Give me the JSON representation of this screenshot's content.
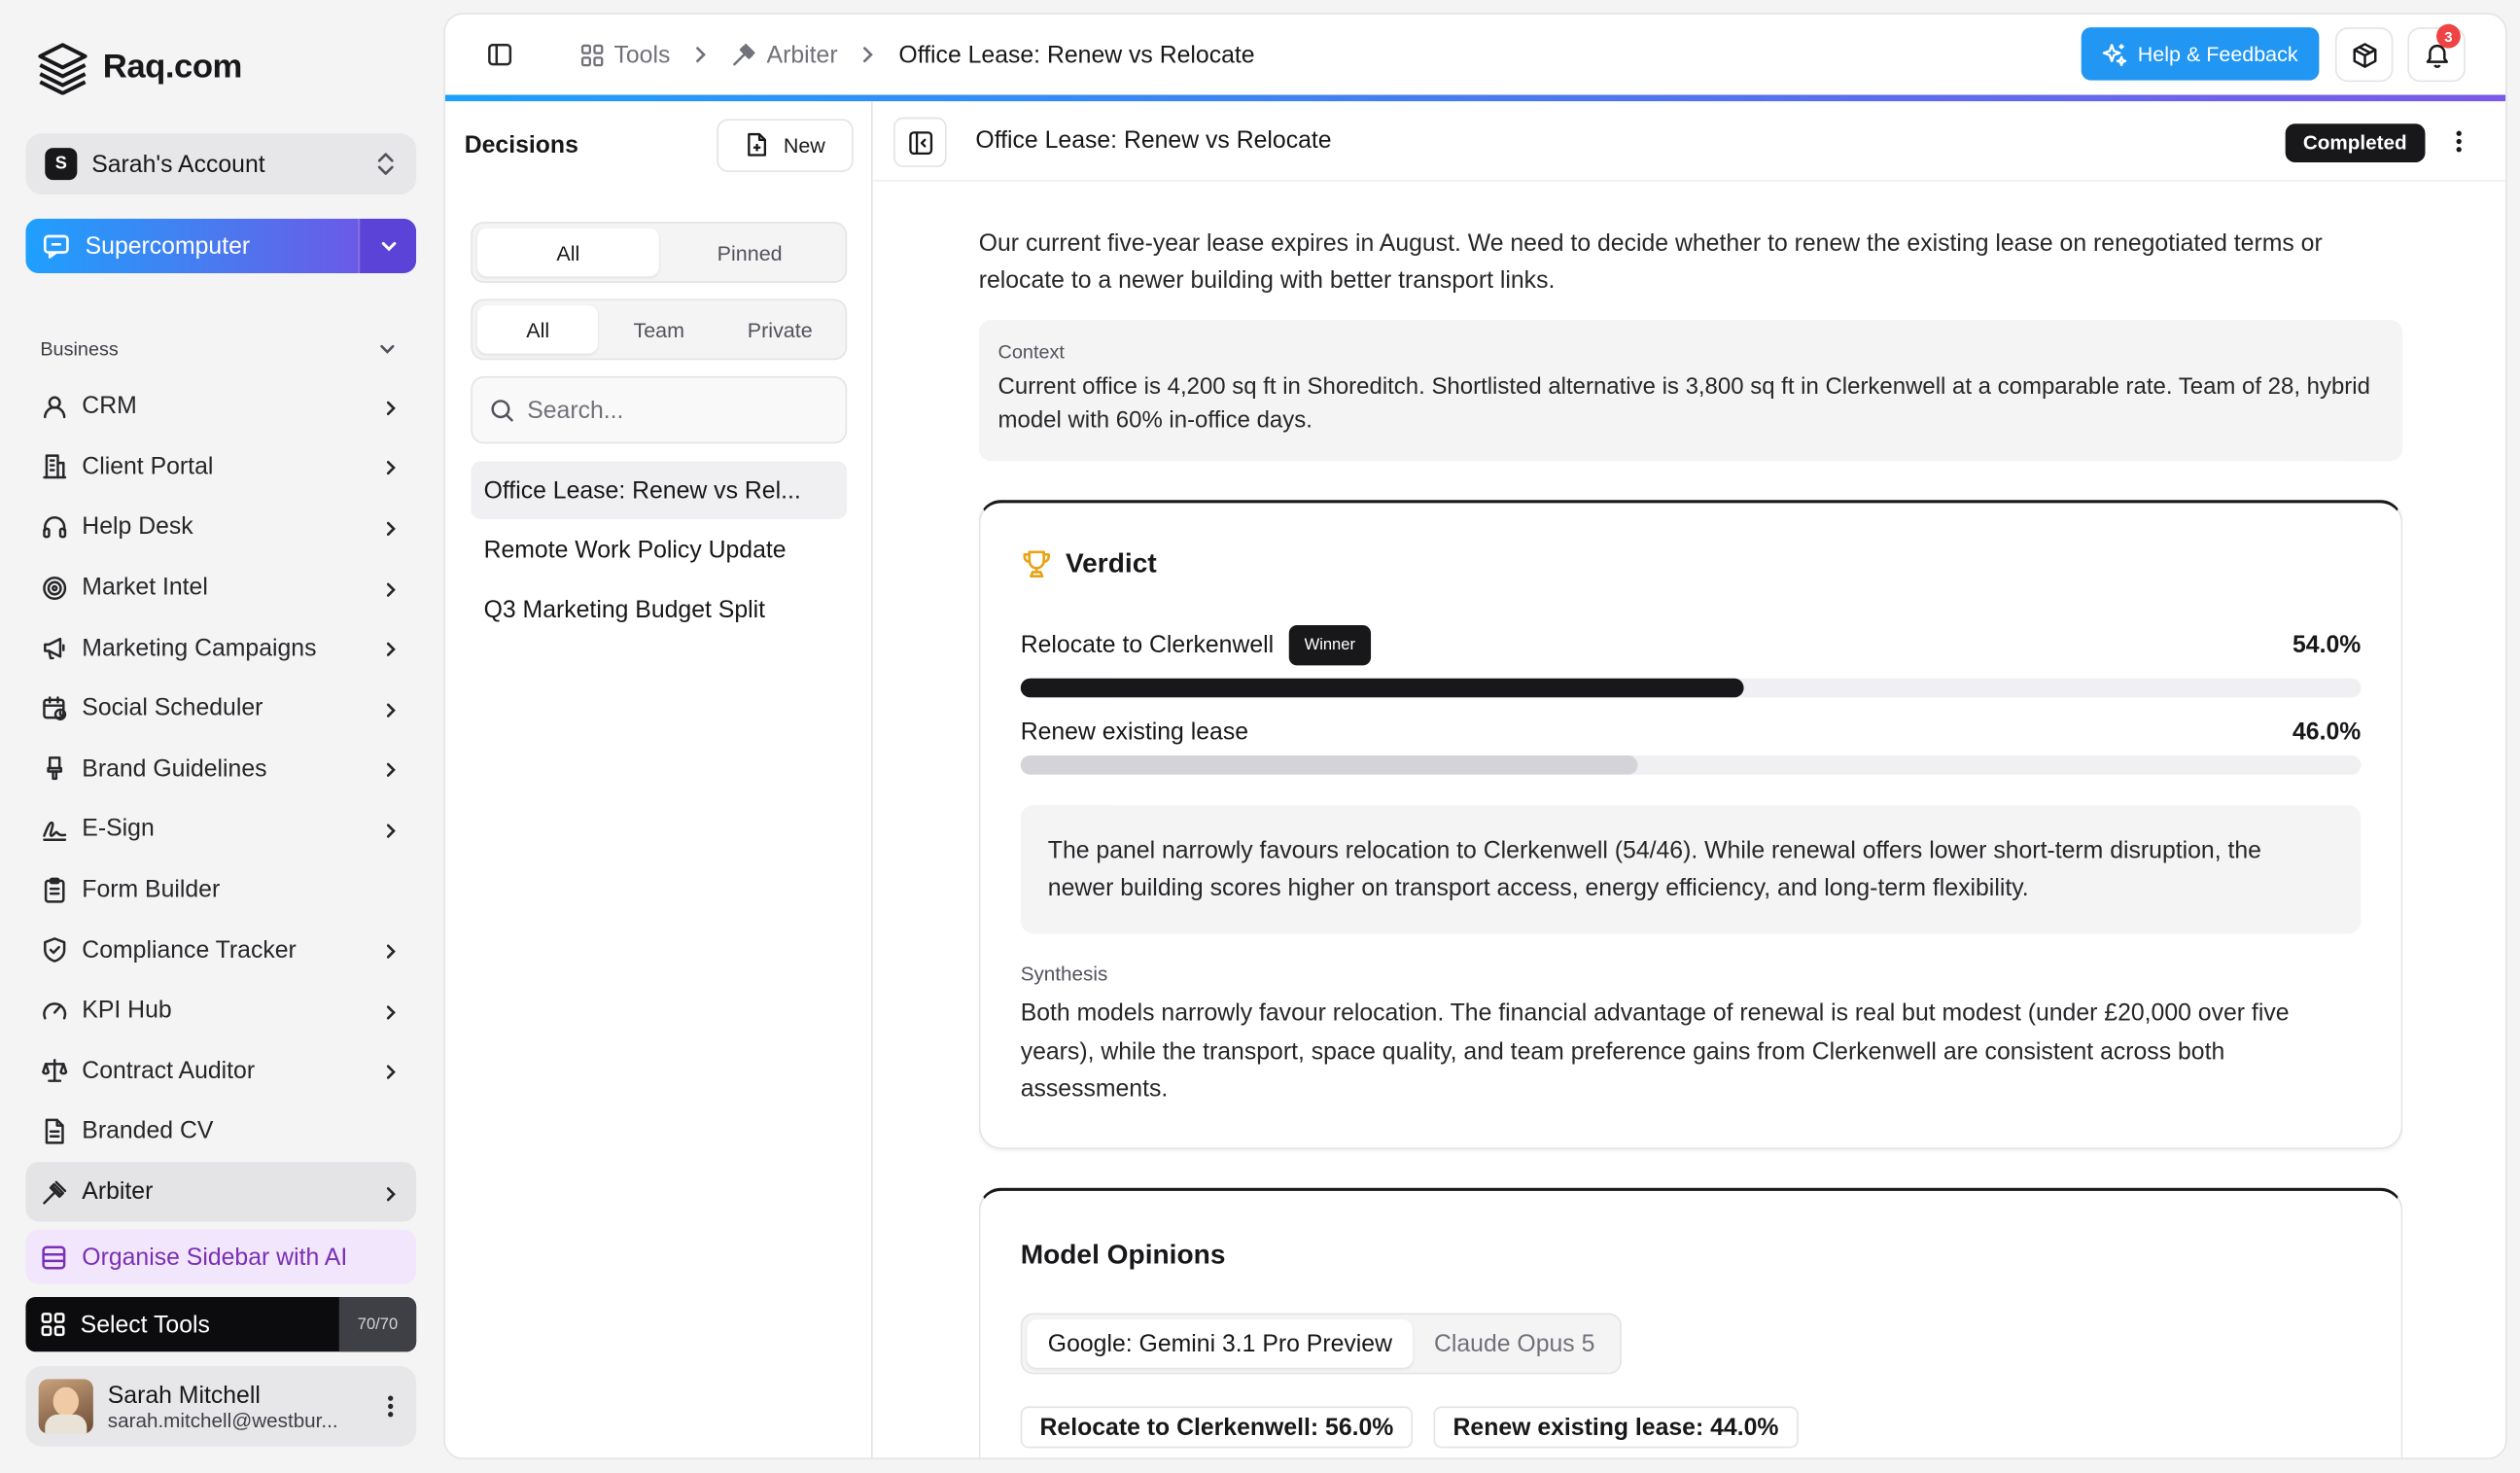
{
  "app": {
    "brand": "Raq.com"
  },
  "account": {
    "name": "Sarah's Account",
    "initial": "S"
  },
  "supercomputer": {
    "label": "Supercomputer"
  },
  "sidebar": {
    "group": "Business",
    "items": [
      {
        "label": "CRM",
        "icon": "user-icon"
      },
      {
        "label": "Client Portal",
        "icon": "building-icon"
      },
      {
        "label": "Help Desk",
        "icon": "headset-icon"
      },
      {
        "label": "Market Intel",
        "icon": "target-icon"
      },
      {
        "label": "Marketing Campaigns",
        "icon": "megaphone-icon"
      },
      {
        "label": "Social Scheduler",
        "icon": "calendar-clock-icon"
      },
      {
        "label": "Brand Guidelines",
        "icon": "brush-icon"
      },
      {
        "label": "E-Sign",
        "icon": "signature-icon"
      },
      {
        "label": "Form Builder",
        "icon": "clipboard-icon"
      },
      {
        "label": "Compliance Tracker",
        "icon": "shield-check-icon"
      },
      {
        "label": "KPI Hub",
        "icon": "gauge-icon"
      },
      {
        "label": "Contract Auditor",
        "icon": "scale-icon"
      },
      {
        "label": "Branded CV",
        "icon": "file-icon"
      },
      {
        "label": "Arbiter",
        "icon": "gavel-icon"
      }
    ],
    "organise": "Organise Sidebar with AI",
    "select_tools": "Select Tools",
    "tools_count": "70/70"
  },
  "user": {
    "name": "Sarah Mitchell",
    "email": "sarah.mitchell@westbur..."
  },
  "breadcrumb": {
    "tools": "Tools",
    "arbiter": "Arbiter",
    "current": "Office Lease: Renew vs Relocate"
  },
  "header": {
    "help": "Help & Feedback",
    "notifications": "3"
  },
  "decisions": {
    "title": "Decisions",
    "new_label": "New",
    "filter1": [
      "All",
      "Pinned"
    ],
    "filter2": [
      "All",
      "Team",
      "Private"
    ],
    "search_placeholder": "Search...",
    "list": [
      "Office Lease: Renew vs Rel...",
      "Remote Work Policy Update",
      "Q3 Marketing Budget Split"
    ]
  },
  "detail": {
    "title": "Office Lease: Renew vs Relocate",
    "status": "Completed",
    "intro": "Our current five-year lease expires in August. We need to decide whether to renew the existing lease on renegotiated terms or relocate to a newer building with better transport links.",
    "context_label": "Context",
    "context": "Current office is 4,200 sq ft in Shoreditch. Shortlisted alternative is 3,800 sq ft in Clerkenwell at a comparable rate. Team of 28, hybrid model with 60% in-office days.",
    "verdict": {
      "title": "Verdict",
      "winner_tag": "Winner",
      "options": [
        {
          "name": "Relocate to Clerkenwell",
          "pct_label": "54.0%",
          "value": 54.0,
          "color": "#18181b"
        },
        {
          "name": "Renew existing lease",
          "pct_label": "46.0%",
          "value": 46.0,
          "color": "#d4d4d8"
        }
      ],
      "summary": "The panel narrowly favours relocation to Clerkenwell (54/46). While renewal offers lower short-term disruption, the newer building scores higher on transport access, energy efficiency, and long-term flexibility.",
      "synthesis_label": "Synthesis",
      "synthesis": "Both models narrowly favour relocation. The financial advantage of renewal is real but modest (under £20,000 over five years), while the transport, space quality, and team preference gains from Clerkenwell are consistent across both assessments."
    },
    "opinions": {
      "title": "Model Opinions",
      "tabs": [
        "Google: Gemini 3.1 Pro Preview",
        "Claude Opus 5"
      ],
      "pills": [
        "Relocate to Clerkenwell: 56.0%",
        "Renew existing lease: 44.0%"
      ]
    }
  }
}
